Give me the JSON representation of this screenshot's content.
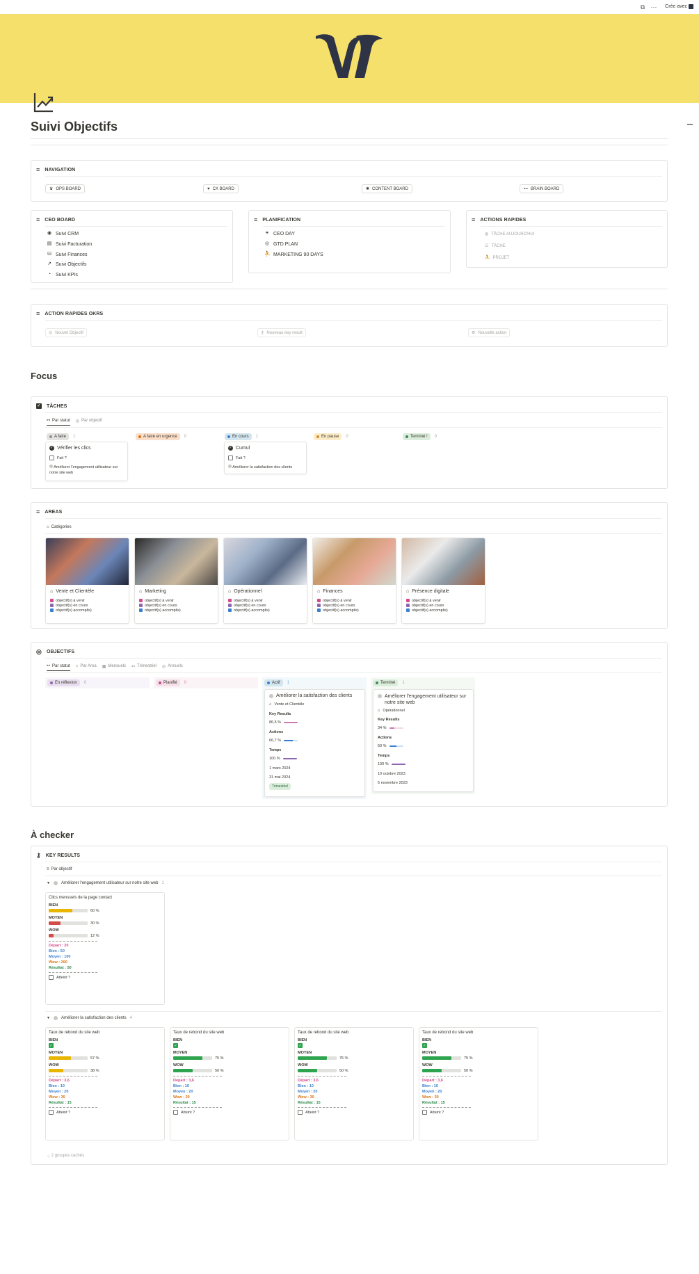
{
  "topbar": {
    "cree_label": "Crée avec"
  },
  "page": {
    "title": "Suivi Objectifs"
  },
  "navigation": {
    "title": "NAVIGATION",
    "buttons": [
      {
        "label": "OPS BOARD",
        "icon": "crown-icon"
      },
      {
        "label": "CX BOARD",
        "icon": "heart-icon"
      },
      {
        "label": "CONTENT BOARD",
        "icon": "palette-icon"
      },
      {
        "label": "BRAIN BOARD",
        "icon": "dumbbell-icon"
      }
    ]
  },
  "ceo_board": {
    "title": "CEO BOARD",
    "items": [
      {
        "label": "Suivi CRM",
        "icon": "user-circle-icon"
      },
      {
        "label": "Suivi Facturation",
        "icon": "invoice-icon"
      },
      {
        "label": "Suivi Finances",
        "icon": "coins-icon"
      },
      {
        "label": "Suivi Objectifs",
        "icon": "chart-line-icon"
      },
      {
        "label": "Suivi KPIs",
        "icon": "pie-icon"
      }
    ]
  },
  "planification": {
    "title": "PLANIFICATION",
    "items": [
      {
        "label": "CEO DAY",
        "icon": "sun-icon"
      },
      {
        "label": "GTD PLAN",
        "icon": "target-icon"
      },
      {
        "label": "MARKETING 90 DAYS",
        "icon": "runner-icon"
      }
    ]
  },
  "actions_rapides": {
    "title": "ACTIONS RAPIDES",
    "items": [
      {
        "label": "TÂCHE AUJOURD'HUI"
      },
      {
        "label": "TÂCHE"
      },
      {
        "label": "PROJET"
      }
    ]
  },
  "okr_actions": {
    "title": "ACTION RAPIDES OKRs",
    "buttons": [
      "Nouvel Objectif",
      "Nouveau key result",
      "Nouvelle action"
    ]
  },
  "focus": {
    "title": "Focus"
  },
  "taches": {
    "title": "TÂCHES",
    "tabs": [
      "Par statut",
      "Par objectif"
    ],
    "columns": [
      {
        "label": "A faire",
        "count": "1",
        "color": "#e3e2e0",
        "dot": "#91918e"
      },
      {
        "label": "A faire en urgence",
        "count": "0",
        "color": "#fadec9",
        "dot": "#d9730d"
      },
      {
        "label": "En cours",
        "count": "1",
        "color": "#d3e5ef",
        "dot": "#3a7fce"
      },
      {
        "label": "En pause",
        "count": "0",
        "color": "#fdecc8",
        "dot": "#cb912f"
      },
      {
        "label": "Terminé !",
        "count": "0",
        "color": "#dbeddb",
        "dot": "#448361"
      }
    ],
    "cards": [
      {
        "title": "Vérifier les clics",
        "fait": "Fait ?",
        "objectif": "Améliorer l'engagement utilisateur sur notre site web"
      },
      {
        "title": "Cumul",
        "fait": "Fait ?",
        "objectif": "Améliorer la satisfaction des clients"
      }
    ]
  },
  "areas": {
    "title": "AREAS",
    "view": "Catégories",
    "meta": [
      "objectif(s) à venir",
      "objectif(s) en cours",
      "objectif(s) accomplis)"
    ],
    "items": [
      {
        "name": "Vente et Clientèle"
      },
      {
        "name": "Marketing"
      },
      {
        "name": "Opérationnel"
      },
      {
        "name": "Finances"
      },
      {
        "name": "Présence digitale"
      }
    ]
  },
  "objectifs": {
    "title": "OBJECTIFS",
    "tabs": [
      "Par statut",
      "Par Area",
      "Mensuels",
      "Trimestriel",
      "Annuels"
    ],
    "columns": [
      {
        "label": "En réflexion",
        "count": "0",
        "color": "#e8deee",
        "dot": "#9065b0",
        "bg": "#f8f5fa"
      },
      {
        "label": "Planifié",
        "count": "0",
        "color": "#f5e0e9",
        "dot": "#c14c8a",
        "bg": "#fbf4f7"
      },
      {
        "label": "Actif",
        "count": "1",
        "color": "#d3e5ef",
        "dot": "#3a7fce",
        "bg": "#f3f8fb"
      },
      {
        "label": "Terminé",
        "count": "1",
        "color": "#dbeddb",
        "dot": "#448361",
        "bg": "#f5f9f4"
      }
    ],
    "cards": [
      {
        "title": "Améliorer la satisfaction des clients",
        "area": "Vente et Clientèle",
        "kr_label": "Key Results",
        "kr_value": "86,5 %",
        "kr_pct": 86.5,
        "actions_label": "Actions",
        "actions_value": "66,7 %",
        "actions_pct": 66.7,
        "temps_label": "Temps",
        "temps_value": "100 %",
        "temps_pct": 100,
        "start": "1 mars 2024",
        "end": "31 mai 2024",
        "tag": "Trimestriel"
      },
      {
        "title": "Améliorer l'engagement utilisateur sur notre site web",
        "area": "Opérationnel",
        "kr_label": "Key Results",
        "kr_value": "34 %",
        "kr_pct": 34,
        "actions_label": "Actions",
        "actions_value": "50 %",
        "actions_pct": 50,
        "temps_label": "Temps",
        "temps_value": "100 %",
        "temps_pct": 100,
        "start": "10 octobre 2023",
        "end": "5 novembre 2023"
      }
    ]
  },
  "a_checker": {
    "title": "À checker"
  },
  "key_results": {
    "title": "KEY RESULTS",
    "view": "Par objectif",
    "groups": [
      {
        "label": "Améliorer l'engagement utilisateur sur notre site web",
        "count": "1"
      },
      {
        "label": "Améliorer la satisfaction des clients",
        "count": "4"
      }
    ],
    "labels": {
      "bien": "BIEN",
      "moyen": "MOYEN",
      "wow": "WOW",
      "atteint": "Atteint ?"
    },
    "group1_card": {
      "title": "Clics mensuels de la page contact",
      "bien_value": "60 %",
      "bien_pct": 60,
      "bien_color": "#e8b500",
      "moyen_value": "30 %",
      "moyen_pct": 30,
      "moyen_color": "#d44c47",
      "wow_value": "12 %",
      "wow_pct": 12,
      "wow_color": "#d44c47",
      "depart": "Départ : 20",
      "bien": "Bien : 50",
      "moyen": "Moyen : 100",
      "wow": "Wow : 200",
      "resultat": "Résultat : 50"
    },
    "group2_cards": [
      {
        "title": "Taux de rebond du site web",
        "moyen_value": "57 %",
        "moyen_pct": 57,
        "moyen_color": "#e8b500",
        "wow_value": "38 %",
        "wow_pct": 38,
        "wow_color": "#e8b500",
        "depart": "Départ : 3,6",
        "bien": "Bien : 10",
        "moyen": "Moyen : 20",
        "wow": "Wow : 30",
        "resultat": "Résultat : 15"
      },
      {
        "title": "Taux de rebond du site web",
        "moyen_value": "75 %",
        "moyen_pct": 75,
        "moyen_color": "#2ea44f",
        "wow_value": "50 %",
        "wow_pct": 50,
        "wow_color": "#2ea44f",
        "depart": "Départ : 3,6",
        "bien": "Bien : 10",
        "moyen": "Moyen : 20",
        "wow": "Wow : 30",
        "resultat": "Résultat : 15"
      },
      {
        "title": "Taux de rebond du site web",
        "moyen_value": "75 %",
        "moyen_pct": 75,
        "moyen_color": "#2ea44f",
        "wow_value": "50 %",
        "wow_pct": 50,
        "wow_color": "#2ea44f",
        "depart": "Départ : 3,6",
        "bien": "Bien : 10",
        "moyen": "Moyen : 20",
        "wow": "Wow : 30",
        "resultat": "Résultat : 15"
      },
      {
        "title": "Taux de rebond du site web",
        "moyen_value": "75 %",
        "moyen_pct": 75,
        "moyen_color": "#2ea44f",
        "wow_value": "50 %",
        "wow_pct": 50,
        "wow_color": "#2ea44f",
        "depart": "Départ : 3,6",
        "bien": "Bien : 10",
        "moyen": "Moyen : 20",
        "wow": "Wow : 30",
        "resultat": "Résultat : 15"
      }
    ],
    "hidden_groups": "2 groupes cachés"
  },
  "colors": {
    "cover": "#f6e06c",
    "logo": "#2e3446"
  }
}
